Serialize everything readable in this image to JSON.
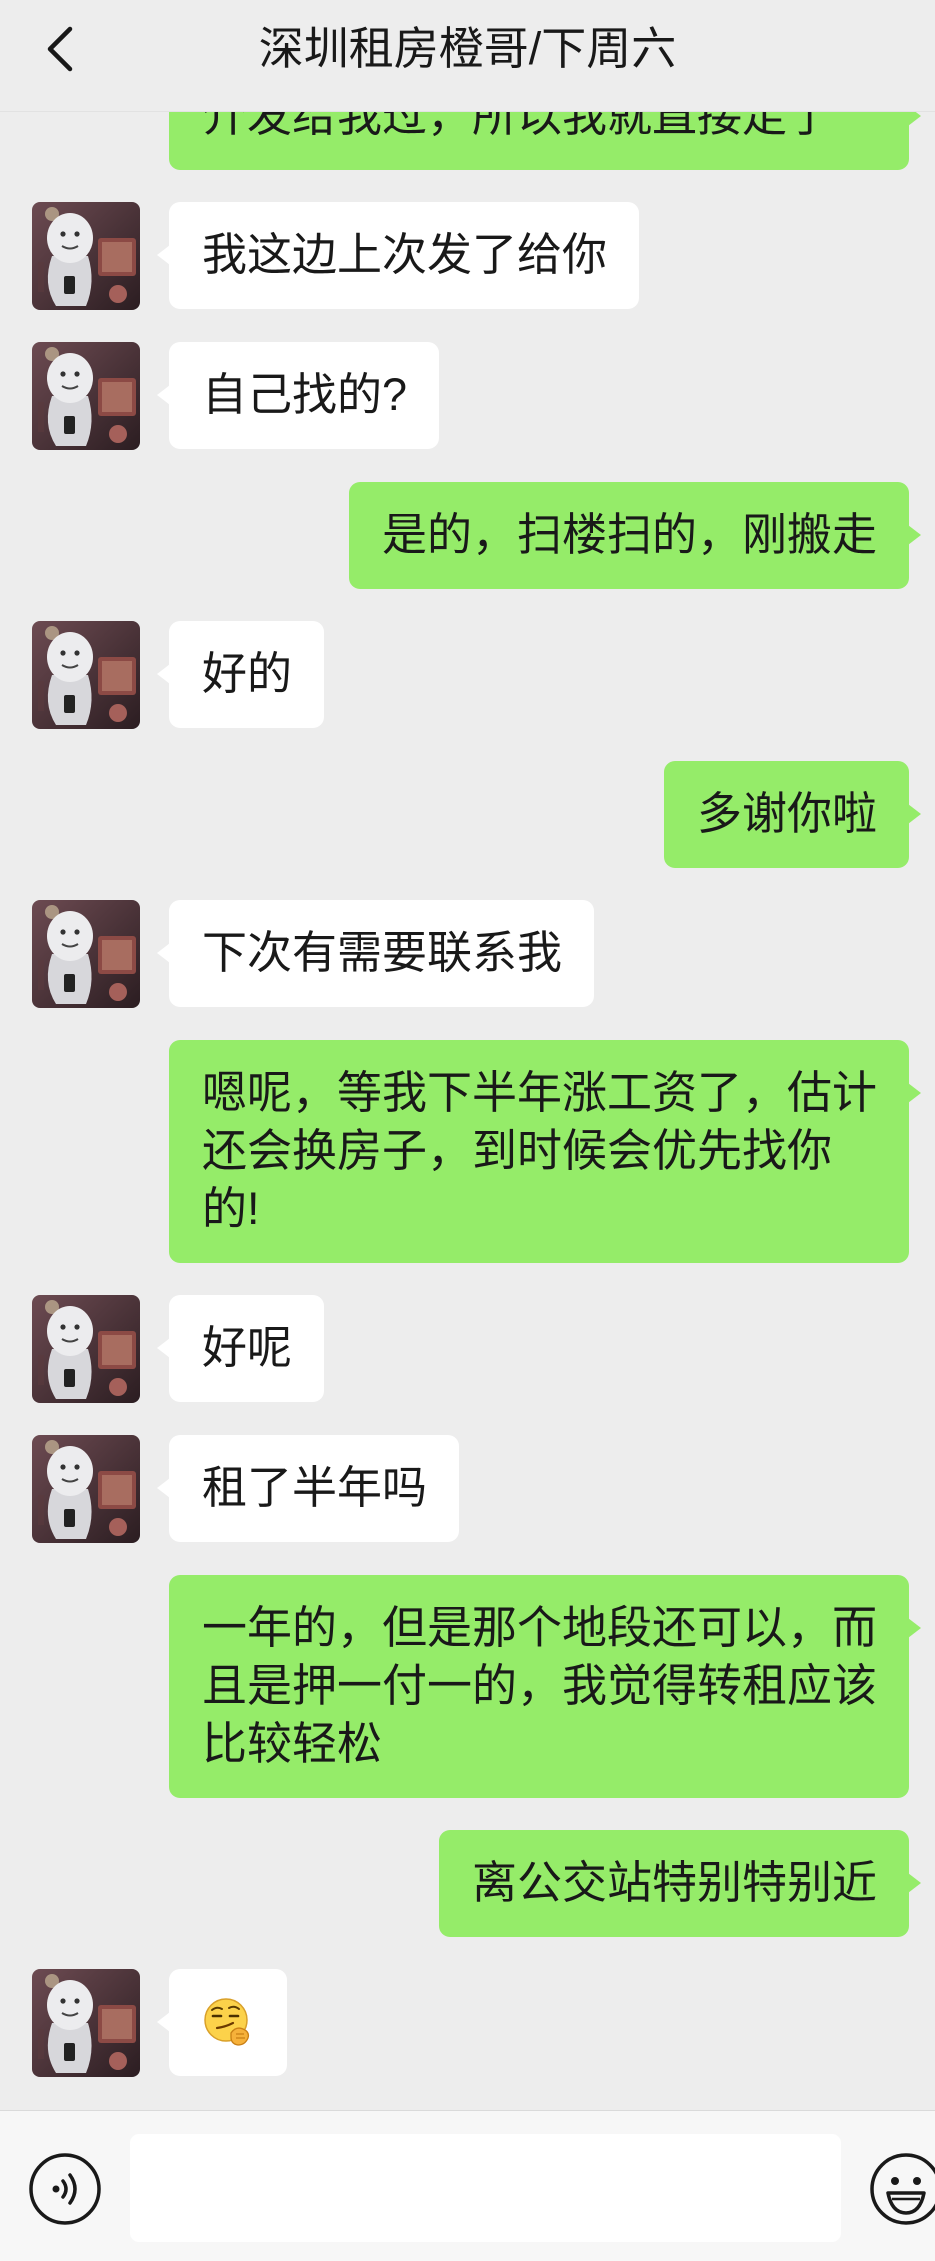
{
  "header": {
    "title": "深圳租房橙哥/下周六",
    "back_icon": "chevron-left-icon"
  },
  "partial_message": {
    "sender": "me",
    "text": "介发给我过，所以我就直接走了"
  },
  "messages": [
    {
      "sender": "contact",
      "lines": [
        "我这边上次发了给你"
      ]
    },
    {
      "sender": "contact",
      "lines": [
        "自己找的?"
      ]
    },
    {
      "sender": "me",
      "lines": [
        "是的，扫楼扫的，刚搬走"
      ]
    },
    {
      "sender": "contact",
      "lines": [
        "好的"
      ]
    },
    {
      "sender": "me",
      "lines": [
        "多谢你啦"
      ]
    },
    {
      "sender": "contact",
      "lines": [
        "下次有需要联系我"
      ]
    },
    {
      "sender": "me",
      "lines": [
        "嗯呢，等我下半年涨工资了，估计",
        "还会换房子，到时候会优先找你",
        "的!"
      ]
    },
    {
      "sender": "contact",
      "lines": [
        "好呢"
      ]
    },
    {
      "sender": "contact",
      "lines": [
        "租了半年吗"
      ]
    },
    {
      "sender": "me",
      "lines": [
        "一年的，但是那个地段还可以，而",
        "且是押一付一的，我觉得转租应该",
        "比较轻松"
      ]
    },
    {
      "sender": "me",
      "lines": [
        "离公交站特别特别近"
      ]
    },
    {
      "sender": "contact",
      "emoji": "smirk-emoji-icon"
    }
  ],
  "input_bar": {
    "voice_icon": "voice-icon",
    "emoji_icon": "emoji-icon",
    "value": ""
  },
  "colors": {
    "page_bg": "#ededed",
    "sent_bubble": "#95ec69",
    "received_bubble": "#ffffff",
    "text": "#191919",
    "input_bar_bg": "#f7f7f7"
  }
}
